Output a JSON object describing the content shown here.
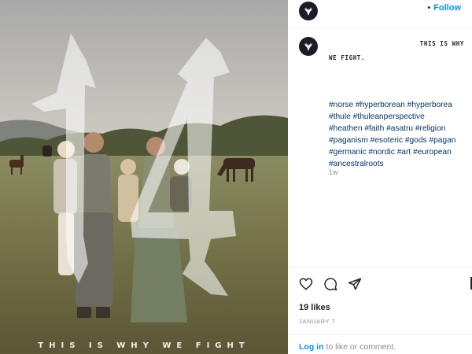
{
  "post": {
    "image_caption": "THIS IS WHY WE FIGHT",
    "overlay_number": "14"
  },
  "header": {
    "avatar_icon": "stag-logo-icon",
    "separator": "•",
    "follow_label": "Follow"
  },
  "comment": {
    "avatar_icon": "stag-logo-icon",
    "line1": "THIS IS WHY",
    "line2": "WE FIGHT.",
    "hashtag_lines": [
      "#norse #hyperborean #hyperborea",
      "#thule #thuleanperspective",
      "#heathen #faith #asatru #religion",
      "#paganism #esoteric #gods #pagan",
      "#germanic #nordic #art #european",
      "#ancestralroots"
    ],
    "time": "1w"
  },
  "actions": {
    "like_icon": "heart-icon",
    "comment_icon": "comment-bubble-icon",
    "share_icon": "paper-plane-icon",
    "save_icon": "bookmark-icon"
  },
  "likes": "19 likes",
  "date": "JANUARY 7",
  "footer": {
    "login_link": "Log in",
    "login_text": "to like or comment."
  },
  "colors": {
    "link_blue": "#0095f6",
    "hashtag_blue": "#00376b",
    "muted_gray": "#8e8e8e"
  }
}
